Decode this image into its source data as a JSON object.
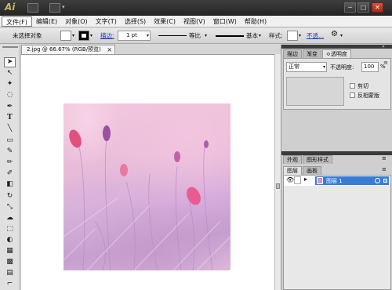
{
  "titlebar": {
    "logo": "Ai",
    "minimize": "─",
    "restore": "□",
    "close": "✕"
  },
  "menu": [
    "文件(F)",
    "编辑(E)",
    "对象(O)",
    "文字(T)",
    "选择(S)",
    "效果(C)",
    "视图(V)",
    "窗口(W)",
    "帮助(H)"
  ],
  "control": {
    "selection": "未选择对象",
    "stroke_label": "描边:",
    "stroke_weight": "1 pt",
    "profile": "等比",
    "brush": "基本",
    "style_label": "样式:",
    "opacity_link": "不透..."
  },
  "document": {
    "tab": "2.jpg @ 66.67% (RGB/预览)",
    "close": "×"
  },
  "panels": {
    "top_tabs": [
      "描边",
      "渐变",
      "≎透明度"
    ],
    "blend_mode": "正常",
    "opacity_label": "不透明度:",
    "opacity_value": "100",
    "opacity_unit": "%",
    "clip": "剪切",
    "invert": "反相蒙版",
    "mid_tabs": [
      "外观",
      "图形样式"
    ],
    "layers_tabs": [
      "图层",
      "画板"
    ],
    "layer_name": "图层 1"
  }
}
